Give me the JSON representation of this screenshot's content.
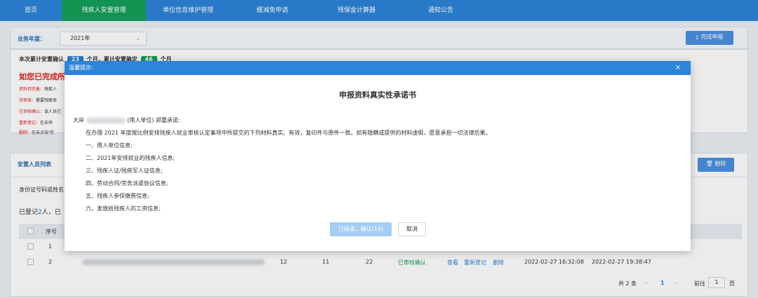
{
  "nav": {
    "items": [
      {
        "label": "首页"
      },
      {
        "label": "残疾人安置管理"
      },
      {
        "label": "单位信息维护管理"
      },
      {
        "label": "缓减免申请"
      },
      {
        "label": "残保金计算器"
      },
      {
        "label": "通知公告"
      }
    ]
  },
  "filter": {
    "year_label": "业务年度：",
    "year_value": "2021年",
    "submit_label": "完成申报"
  },
  "summary": {
    "text_a": "本次累计安置确认",
    "count_a": "23",
    "unit_a": "个月，累计安置确定",
    "count_b": "46",
    "unit_b": "个月",
    "warning": "如您已完成所",
    "notes": [
      {
        "key": "资料待完善：",
        "text": "残疾人"
      },
      {
        "key": "待审核：",
        "text": "需要残联审"
      },
      {
        "key": "已审核确认：",
        "text": "该人员已"
      },
      {
        "key": "重新登记：",
        "text": "在未申"
      },
      {
        "key": "删除：",
        "text": "在未点击'完"
      }
    ]
  },
  "list": {
    "title": "安置人员列表",
    "delete_label": "删除",
    "search_label": "身份证号码或姓名",
    "registered_prefix": "已登记",
    "registered_count": "2",
    "registered_suffix": "人，已",
    "header_index": "序号",
    "rows": [
      {
        "index": "1"
      },
      {
        "index": "2",
        "c1": "12",
        "c2": "11",
        "c3": "22",
        "status": "已审核确认",
        "view": "查看",
        "reregister": "重新登记",
        "delete": "删除",
        "time1": "2022-02-27 16:32:08",
        "time2": "2022-02-27 19:38:47"
      }
    ],
    "pager": {
      "total": "共 2 条",
      "prev": "‹",
      "page": "1",
      "next": "›",
      "goto": "前往",
      "goto_value": "1",
      "page_unit": "页"
    }
  },
  "modal": {
    "header": "温馨提示:",
    "close": "×",
    "title": "申报资料真实性承诺书",
    "lead_prefix": "大岸",
    "lead_suffix": "(用人单位) 郑重承诺:",
    "body": "在办理 2021 年度按比例安排残疾人就业审核认定事项中所提交的下列材料真实、有效，复印件与原件一致。如有隐瞒或提供的材料虚假，愿意承担一切法律后果。",
    "items": [
      "一、用人单位信息;",
      "二、2021年安排就业的残疾人信息;",
      "三、残疾人证/残疾军人证信息;",
      "四、劳动合同/劳务派遣协议信息;",
      "五、残疾人参保缴费信息;",
      "六、发放给残疾人的工资信息;"
    ],
    "confirm_label": "已阅读，确认(14)",
    "cancel_label": "取消"
  },
  "colors": {
    "nav_bg": "#2c85d9",
    "nav_active": "#14a05a",
    "danger": "#e02020",
    "success": "#14a05a",
    "link": "#2c85d9"
  },
  "icons": [
    "chevron-down-icon",
    "document-icon",
    "trash-icon",
    "close-icon"
  ]
}
